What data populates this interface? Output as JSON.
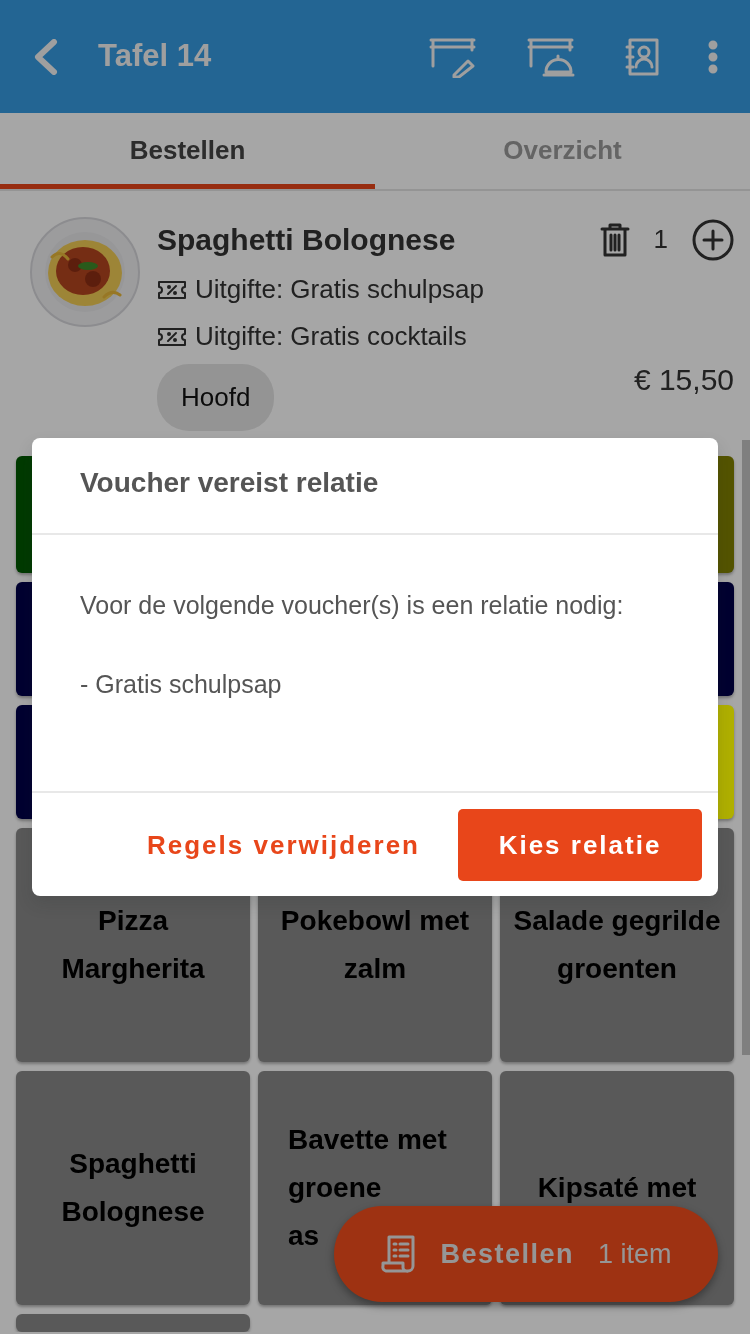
{
  "header": {
    "title": "Tafel 14"
  },
  "tabs": [
    {
      "label": "Bestellen",
      "selected": true
    },
    {
      "label": "Overzicht",
      "selected": false
    }
  ],
  "order_items": [
    {
      "name": "Spaghetti Bolognese",
      "quantity": "1",
      "vouchers": [
        "Uitgifte: Gratis schulpsap",
        "Uitgifte: Gratis cocktails"
      ],
      "tag": "Hoofd",
      "price": "€ 15,50"
    }
  ],
  "categories": [
    {
      "color": "#003a00"
    },
    {
      "color": "#545400"
    },
    {
      "color": "#000030"
    },
    {
      "color": "#000030"
    },
    {
      "color": "#000030"
    },
    {
      "color": "#b0b000"
    }
  ],
  "products": [
    {
      "label": "Pizza\nMargherita",
      "cut_off": false
    },
    {
      "label": "Pokebowl met\nzalm",
      "cut_off": false
    },
    {
      "label": "Salade gegrilde\ngroenten",
      "cut_off": false
    },
    {
      "label": "Spaghetti\nBolognese",
      "cut_off": false
    },
    {
      "label": "Bavette met\ngroene\nas",
      "cut_off": true
    },
    {
      "label": "Kipsaté met",
      "cut_off": false
    }
  ],
  "more_products_below": true,
  "order_button": {
    "label": "Bestellen",
    "count": "1 item"
  },
  "dialog": {
    "title": "Voucher vereist relatie",
    "message": [
      "Voor de volgende voucher(s) is een relatie nodig:",
      "- Gratis schulpsap"
    ],
    "secondary_button": "Regels verwijderen",
    "primary_button": "Kies relatie"
  }
}
